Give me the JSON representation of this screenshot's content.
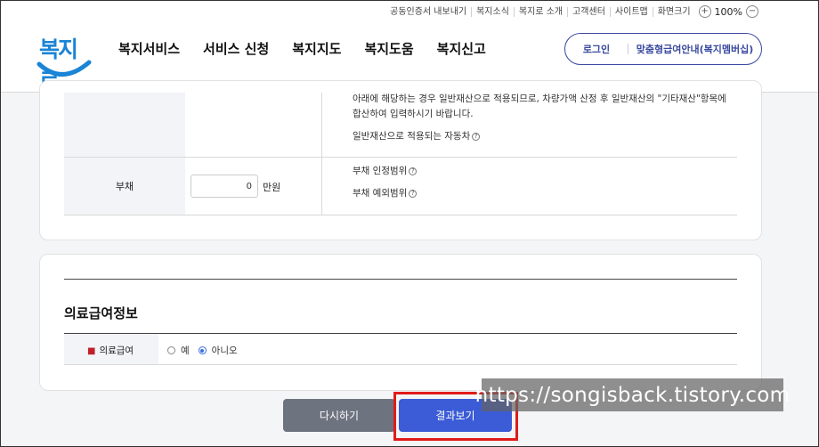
{
  "util_links": [
    "공동인증서 내보내기",
    "복지소식",
    "복지로 소개",
    "고객센터",
    "사이트맵",
    "화면크기"
  ],
  "zoom": {
    "plus": "+",
    "minus": "−",
    "value": "100%"
  },
  "logo_text": "복지로",
  "gnb": [
    "복지서비스",
    "서비스 신청",
    "복지지도",
    "복지도움",
    "복지신고"
  ],
  "login": {
    "login_label": "로그인",
    "guide_label": "맞춤형급여안내(복지멤버십)"
  },
  "asset_note": "아래에 해당하는 경우 일반재산으로 적용되므로, 차량가액 산정 후 일반재산의 \"기타재산\"항목에 합산하여 입력하시기 바랍니다.",
  "vehicle_link": "일반재산으로 적용되는 자동차",
  "debt": {
    "label": "부채",
    "value": "0",
    "unit": "만원",
    "range_link": "부채 인정범위",
    "except_link": "부채 예외범위"
  },
  "medical": {
    "title": "의료급여정보",
    "required_mark": "■",
    "field_label": "의료급여",
    "options": [
      {
        "label": "예",
        "checked": false
      },
      {
        "label": "아니오",
        "checked": true
      }
    ]
  },
  "buttons": {
    "reset": "다시하기",
    "result": "결과보기"
  },
  "watermark": "https://songisback.tistory.com",
  "colors": {
    "brand": "#1a84d6",
    "accent": "#3b5cd6",
    "highlight": "#e01b1b",
    "reset_button": "#6e7380"
  }
}
